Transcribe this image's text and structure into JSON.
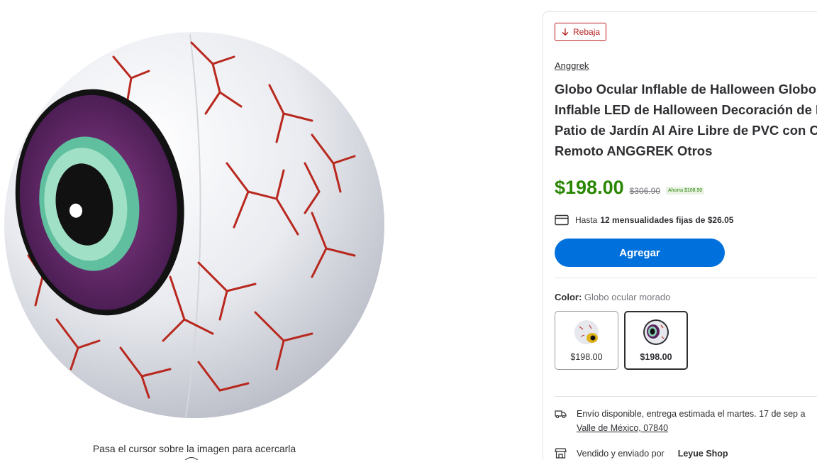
{
  "image_area": {
    "hover_hint": "Pasa el cursor sobre la imagen para acercarla",
    "image_icon": "inflatable-eyeball-image"
  },
  "product": {
    "badge_label": "Rebaja",
    "badge_icon": "arrow-down-icon",
    "brand": "Anggrek",
    "title_lines": [
      "Globo Ocular Inflable de Halloween Globo O",
      "Inflable LED de Halloween Decoración de H",
      "Patio de Jardín Al Aire Libre de PVC con Co",
      "Remoto ANGGREK Otros"
    ],
    "price": "$198.00",
    "old_price": "$306.90",
    "savings": "Ahorra $108.90",
    "installments_prefix": "Hasta",
    "installments_bold": "12 mensualidades fijas de $26.05",
    "add_button": "Agregar",
    "color_label": "Color:",
    "color_value": "Globo ocular morado",
    "swatches": [
      {
        "price": "$198.00",
        "selected": false
      },
      {
        "price": "$198.00",
        "selected": true
      }
    ],
    "delivery_text": "Envío disponible, entrega estimada el martes. 17 de sep a",
    "delivery_location": "Valle de México, 07840",
    "seller_prefix": "Vendido y enviado por",
    "seller_name": "Leyue Shop"
  },
  "colors": {
    "accent_blue": "#0071dc",
    "price_green": "#2a8703",
    "badge_red": "#b91c1c"
  }
}
